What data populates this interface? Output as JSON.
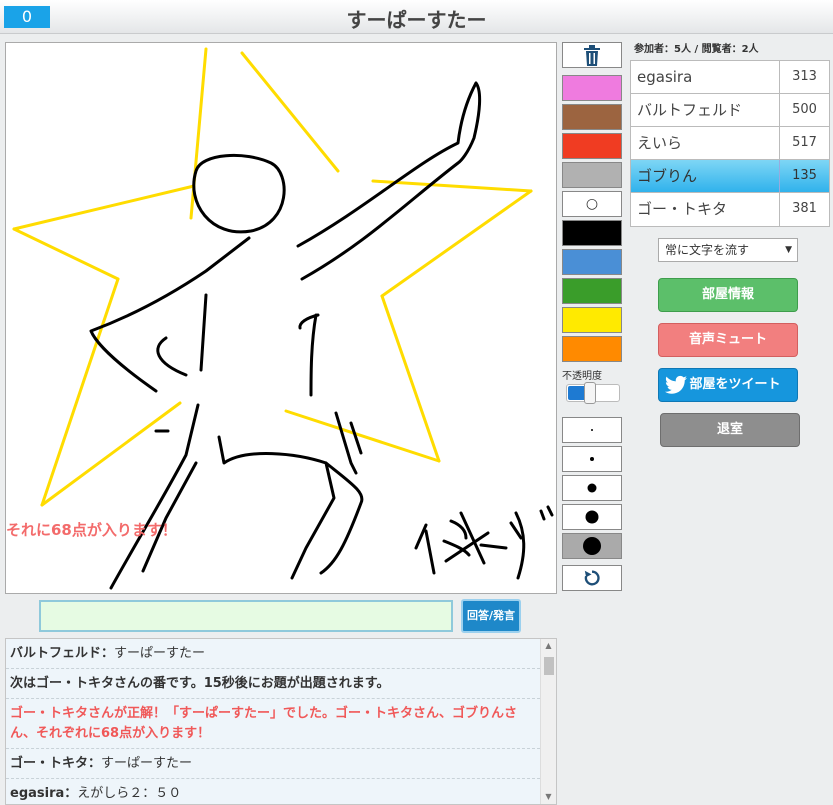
{
  "header": {
    "timer": "0",
    "title": "すーぱーすたー"
  },
  "canvas": {
    "flow_text": "それに68点が入ります！"
  },
  "tools": {
    "colors": [
      "#ef7bdf",
      "#9c6440",
      "#f03c22",
      "#b1b1b1",
      "#000000",
      "#4a8fd6",
      "#3a9d2a",
      "#ffea00",
      "#ff8a00"
    ],
    "eraser_label": "○",
    "opacity_label": "不透明度",
    "opacity_value": 0.45
  },
  "room": {
    "counts": "参加者：5人 / 閲覧者：2人",
    "players": [
      {
        "name": "egasira",
        "score": "313",
        "active": false
      },
      {
        "name": "バルトフェルド",
        "score": "500",
        "active": false
      },
      {
        "name": "えいら",
        "score": "517",
        "active": false
      },
      {
        "name": "ゴブりん",
        "score": "135",
        "active": true
      },
      {
        "name": "ゴー・トキタ",
        "score": "381",
        "active": false
      }
    ],
    "mode_select": "常に文字を流す",
    "room_info_button": "部屋情報",
    "mute_button": "音声ミュート",
    "tweet_button": "部屋をツイート",
    "exit_button": "退室"
  },
  "input": {
    "value": "",
    "answer_button": "回答/発言"
  },
  "chat": [
    {
      "type": "user",
      "who": "バルトフェルド：",
      "text": "すーぱーすたー"
    },
    {
      "type": "system",
      "who": "",
      "text": "次はゴー・トキタさんの番です。15秒後にお題が出題されます。"
    },
    {
      "type": "correct",
      "who": "",
      "text": "ゴー・トキタさんが正解！「すーぱーすたー」でした。ゴー・トキタさん、ゴブりんさん、それぞれに68点が入ります！"
    },
    {
      "type": "user",
      "who": "ゴー・トキタ：",
      "text": "すーぱーすたー"
    },
    {
      "type": "user",
      "who": "egasira：",
      "text": "えがしら２：５０"
    }
  ]
}
